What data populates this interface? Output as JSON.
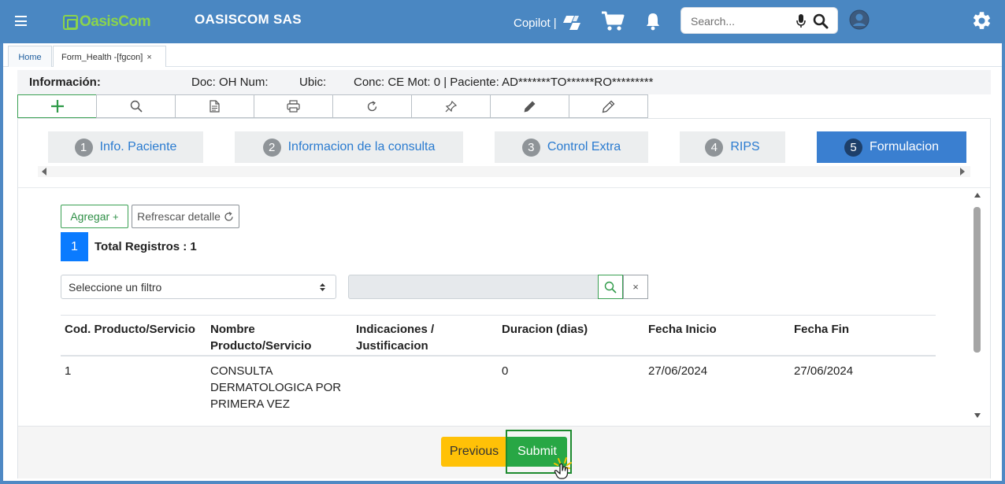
{
  "header": {
    "logo_text_a": "Oasis",
    "logo_text_b": "Com",
    "company": "OASISCOM SAS",
    "copilot_label": "Copilot",
    "copilot_sep": "|",
    "search_placeholder": "Search...",
    "icons": [
      "hamburger-menu-icon",
      "copilot-icon",
      "cart-icon",
      "bell-icon",
      "mic-icon",
      "search-icon",
      "user-avatar-icon",
      "settings-gear-icon"
    ]
  },
  "tabs": {
    "home": "Home",
    "form": "Form_Health -[fgcon]",
    "close": "×"
  },
  "info": {
    "title": "Información:",
    "doc": "Doc: OH Num:",
    "ubic": "Ubic:",
    "conc": "Conc: CE Mot: 0 | Paciente: AD*******TO******RO*********"
  },
  "toolbar": {
    "buttons": [
      "add-icon",
      "search-icon",
      "document-icon",
      "print-icon",
      "refresh-icon",
      "pin-icon",
      "pen-icon",
      "pencil-icon"
    ]
  },
  "steps": [
    {
      "num": "1",
      "label": "Info. Paciente",
      "active": false
    },
    {
      "num": "2",
      "label": "Informacion de la consulta",
      "active": false
    },
    {
      "num": "3",
      "label": "Control Extra",
      "active": false
    },
    {
      "num": "4",
      "label": "RIPS",
      "active": false
    },
    {
      "num": "5",
      "label": "Formulacion",
      "active": true
    }
  ],
  "actions": {
    "agregar": "Agregar",
    "agregar_sign": "+",
    "refrescar": "Refrescar detalle"
  },
  "pagination": {
    "current_page": "1",
    "total": "Total Registros : 1"
  },
  "filter": {
    "select_value": "Seleccione un filtro",
    "input_value": "",
    "clear": "×"
  },
  "table": {
    "headers": [
      "Cod. Producto/Servicio",
      "Nombre Producto/Servicio",
      "Indicaciones / Justificacion",
      "Duracion (dias)",
      "Fecha Inicio",
      "Fecha Fin"
    ],
    "rows": [
      [
        "1",
        "CONSULTA DERMATOLOGICA POR PRIMERA VEZ",
        "",
        "0",
        "27/06/2024",
        "27/06/2024"
      ]
    ]
  },
  "footer": {
    "previous": "Previous",
    "submit": "Submit"
  },
  "colors": {
    "header_bg": "#4a87c2",
    "logo_green": "#8bd44c",
    "step_active": "#3a7fd0",
    "btn_previous": "#ffc107",
    "btn_submit": "#28a745",
    "page_badge": "#0a7bff"
  }
}
